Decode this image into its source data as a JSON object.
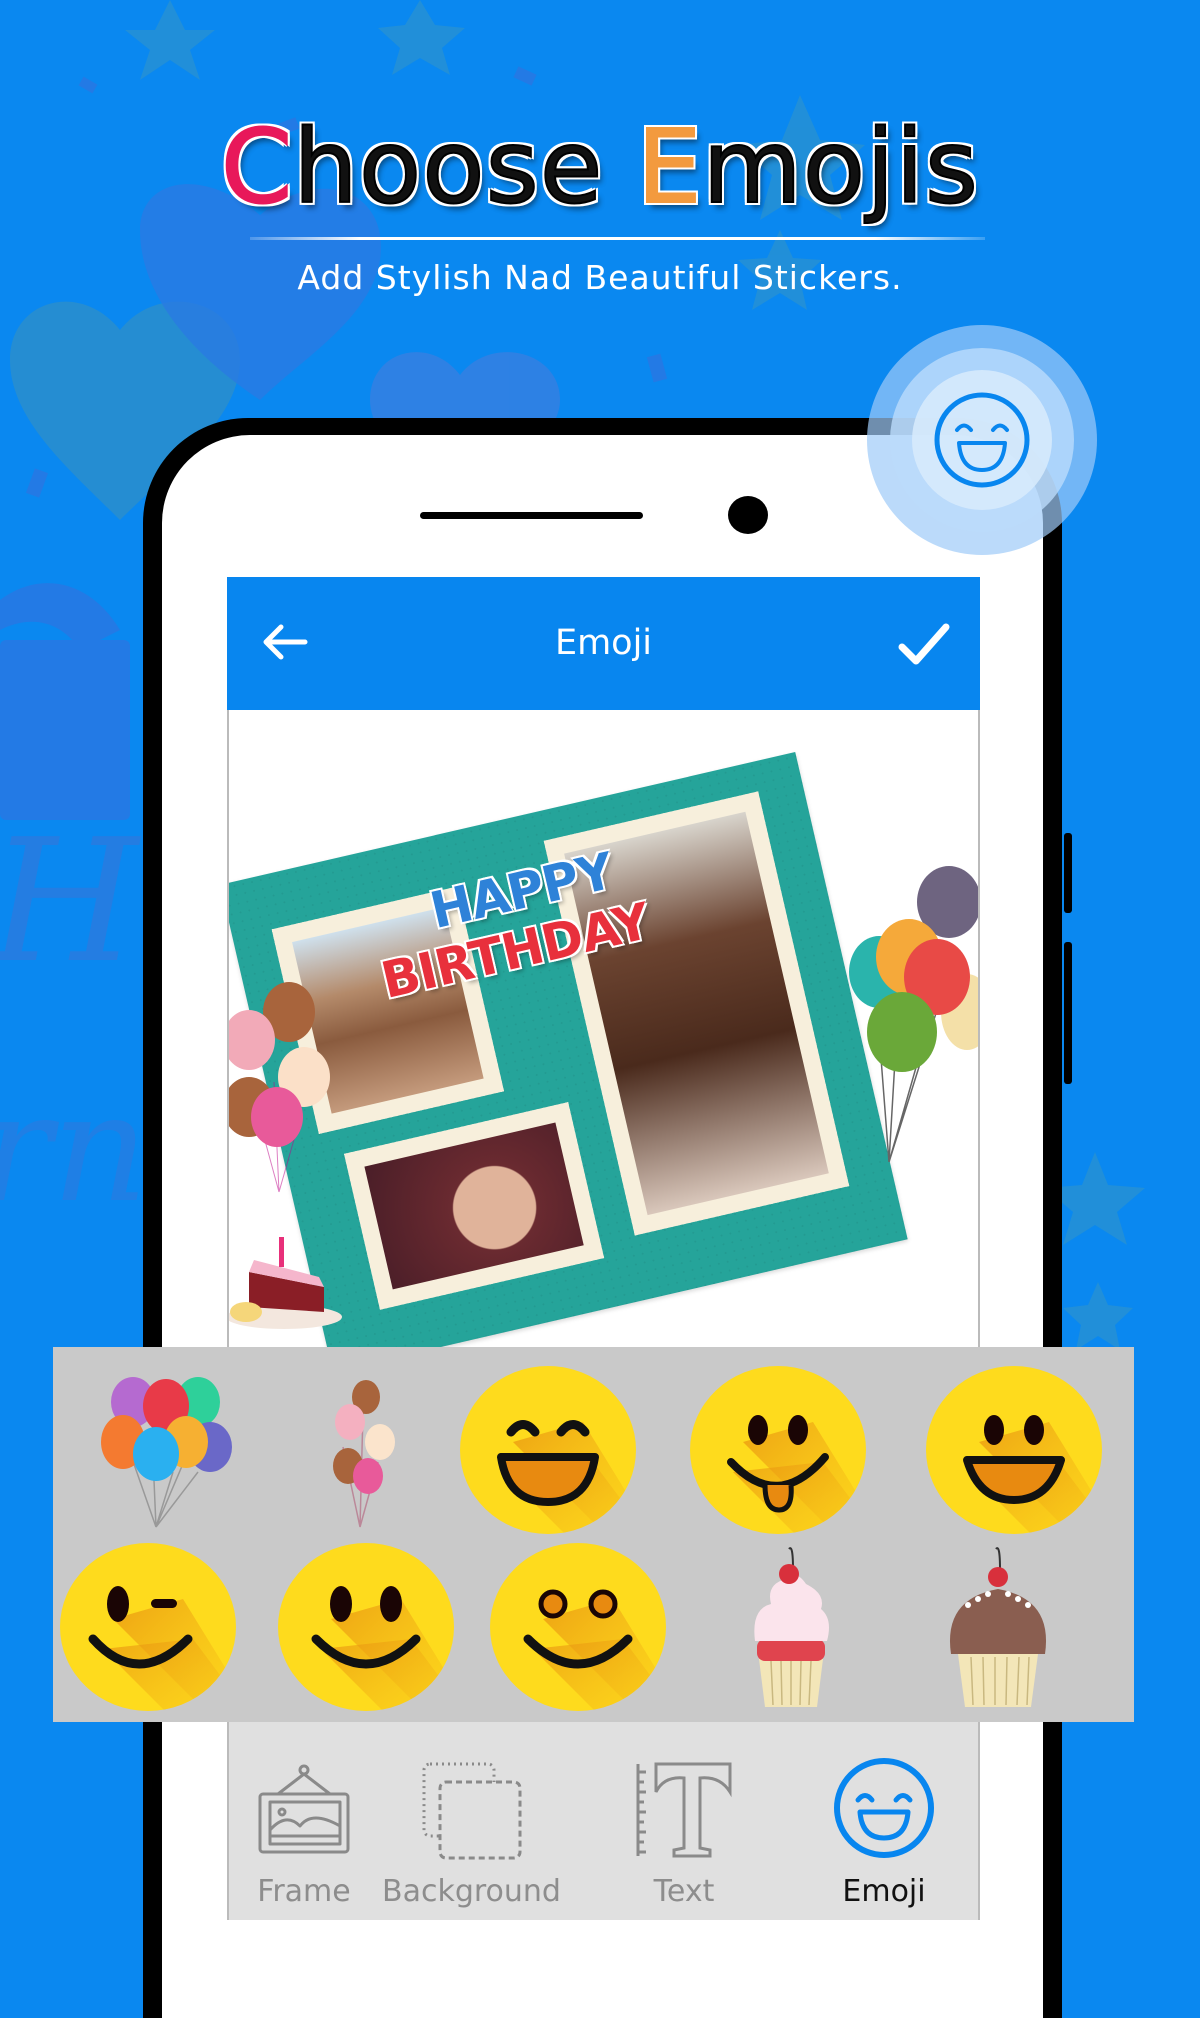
{
  "promo": {
    "title_first_letter": "C",
    "title_rest_1": "hoose ",
    "title_second_letter": "E",
    "title_rest_2": "mojis",
    "subtitle": "Add Stylish Nad Beautiful Stickers.",
    "title_accent_1": "#e8185a",
    "title_accent_2": "#f39a3e",
    "background_color": "#0a88f0"
  },
  "feature_badge": {
    "icon": "laughing-face-icon"
  },
  "app": {
    "header": {
      "title": "Emoji",
      "back_icon": "arrow-left-icon",
      "confirm_icon": "checkmark-icon",
      "color": "#0886ef"
    },
    "canvas": {
      "card_text_line1": "HAPPY",
      "card_text_line2": "BIRTHDAY",
      "photos": [
        "photo-1",
        "photo-2",
        "photo-3"
      ]
    },
    "sticker_panel": {
      "stickers": [
        {
          "name": "colorful-balloons"
        },
        {
          "name": "pastel-balloons"
        },
        {
          "name": "laughing-emoji"
        },
        {
          "name": "tongue-out-emoji"
        },
        {
          "name": "grinning-emoji"
        },
        {
          "name": "winking-emoji"
        },
        {
          "name": "smiling-emoji"
        },
        {
          "name": "round-eyes-emoji"
        },
        {
          "name": "strawberry-cupcake"
        },
        {
          "name": "chocolate-cupcake"
        }
      ]
    },
    "bottom_nav": {
      "items": [
        {
          "label": "Frame",
          "icon": "frame-picture-icon",
          "active": false
        },
        {
          "label": "Background",
          "icon": "background-layers-icon",
          "active": false
        },
        {
          "label": "Text",
          "icon": "text-t-icon",
          "active": false
        },
        {
          "label": "Emoji",
          "icon": "emoji-face-icon",
          "active": true
        }
      ],
      "active_color": "#0886ef"
    }
  }
}
